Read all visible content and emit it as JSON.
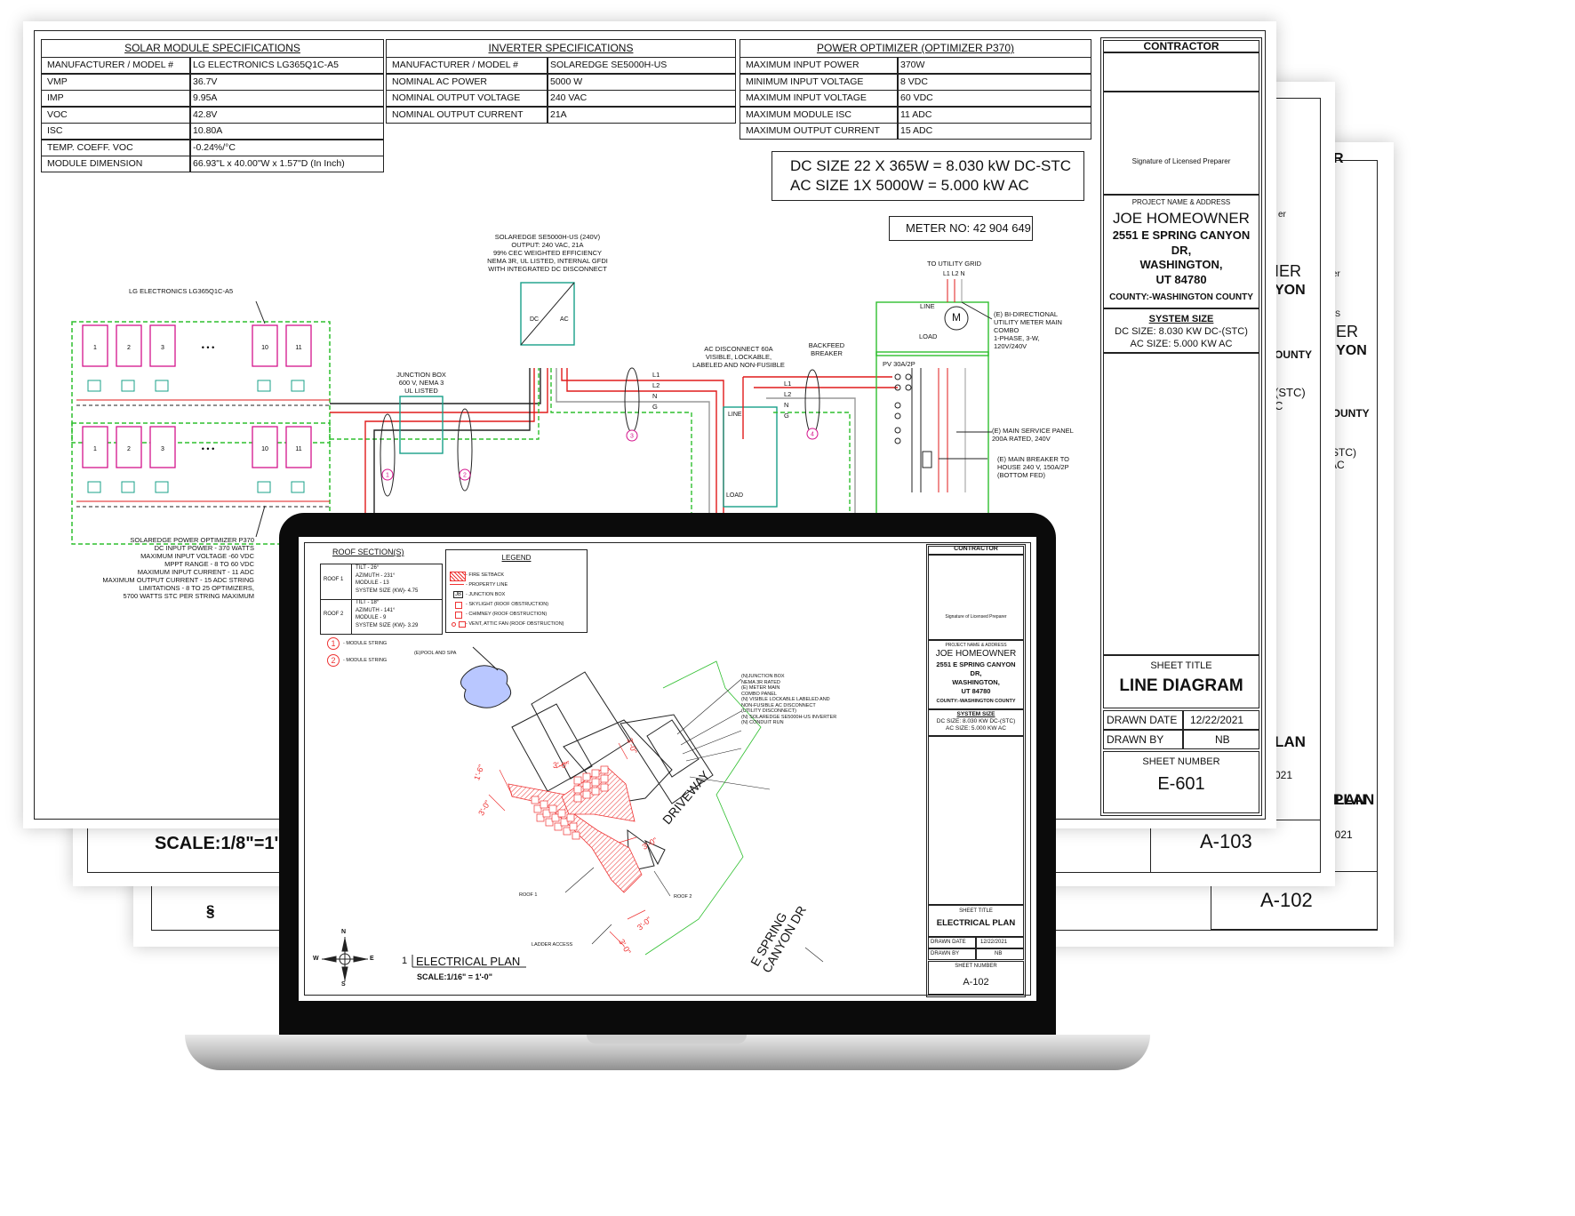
{
  "back_sheet_a102": {
    "fragments": [
      "R",
      "arer",
      "ESS",
      "NER",
      "ANYON",
      "COUNTY",
      "-(STC)",
      "AC",
      "LAN",
      "2021"
    ],
    "scale_label": "SCALE:1/8\"=1'-",
    "north_label": "S",
    "sheet_number": "A-102"
  },
  "back_sheet_a103": {
    "fragments": [
      "er",
      "IER",
      "YON",
      "OUNTY",
      "(STC)",
      "C",
      "LAN",
      "021",
      "PLAN"
    ],
    "sheet_number": "A-103"
  },
  "main_sheet": {
    "solar_module": {
      "title": "SOLAR MODULE SPECIFICATIONS",
      "rows": [
        [
          "MANUFACTURER / MODEL #",
          "LG ELECTRONICS LG365Q1C-A5"
        ],
        [
          "VMP",
          "36.7V"
        ],
        [
          "IMP",
          "9.95A"
        ],
        [
          "VOC",
          "42.8V"
        ],
        [
          "ISC",
          "10.80A"
        ],
        [
          "TEMP. COEFF. VOC",
          "-0.24%/°C"
        ],
        [
          "MODULE DIMENSION",
          "66.93\"L x 40.00\"W x 1.57\"D (In Inch)"
        ]
      ]
    },
    "inverter": {
      "title": "INVERTER  SPECIFICATIONS",
      "rows": [
        [
          "MANUFACTURER / MODEL #",
          "SOLAREDGE SE5000H-US"
        ],
        [
          "NOMINAL AC POWER",
          "5000 W"
        ],
        [
          "NOMINAL OUTPUT VOLTAGE",
          "240 VAC"
        ],
        [
          "NOMINAL OUTPUT CURRENT",
          " 21A"
        ]
      ]
    },
    "optimizer": {
      "title": "POWER OPTIMIZER (OPTIMIZER  P370)",
      "rows": [
        [
          "MAXIMUM INPUT POWER",
          "370W"
        ],
        [
          "MINIMUM INPUT VOLTAGE",
          "8 VDC"
        ],
        [
          "MAXIMUM INPUT VOLTAGE",
          "60 VDC"
        ],
        [
          "MAXIMUM MODULE ISC",
          "11 ADC"
        ],
        [
          "MAXIMUM OUTPUT CURRENT",
          "15 ADC"
        ]
      ]
    },
    "size_box": [
      "DC SIZE 22 X 365W = 8.030 kW DC-STC",
      "AC SIZE 1X 5000W = 5.000 kW AC"
    ],
    "meter_no": "METER NO: 42 904 649",
    "labels": {
      "module_label": "LG ELECTRONICS LG365Q1C-A5",
      "inverter_note": [
        "SOLAREDGE SE5000H-US (240V)",
        "OUTPUT: 240 VAC, 21A",
        "99% CEC WEIGHTED EFFICIENCY",
        "NEMA 3R, UL LISTED, INTERNAL GFDI",
        "WITH INTEGRATED DC DISCONNECT"
      ],
      "to_grid": "TO UTILITY GRID",
      "grid_lines": "L1 L2  N",
      "meter_note": [
        "(E) BI-DIRECTIONAL",
        "UTILITY METER MAIN",
        "COMBO",
        "1-PHASE, 3-W,",
        "120V/240V"
      ],
      "line": "LINE",
      "load": "LOAD",
      "meter_symbol": "M",
      "ac_disconnect": [
        "AC DISCONNECT 60A",
        "VISIBLE, LOCKABLE,",
        "LABELED AND NON-FUSIBLE"
      ],
      "backfeed": [
        "BACKFEED",
        "BREAKER"
      ],
      "pv_breaker": "PV 30A/2P",
      "junction_box": [
        "JUNCTION BOX",
        "600 V, NEMA 3",
        "UL LISTED"
      ],
      "main_panel": [
        "(E) MAIN SERVICE PANEL",
        "200A RATED, 240V"
      ],
      "main_breaker": [
        "(E) MAIN BREAKER TO",
        "HOUSE 240 V, 150A/2P",
        "(BOTTOM FED)"
      ],
      "optimizer_note": [
        "SOLAREDGE POWER OPTIMIZER P370",
        "DC INPUT POWER - 370 WATTS",
        "MAXIMUM INPUT VOLTAGE -60 VDC",
        "MPPT RANGE - 8 TO 60 VDC",
        "MAXIMUM INPUT CURRENT - 11 ADC",
        "MAXIMUM OUTPUT CURRENT - 15 ADC STRING",
        "LIMITATIONS - 8 TO 25 OPTIMIZERS,",
        "5700 WATTS STC PER STRING MAXIMUM"
      ],
      "wire_tags": [
        "L1",
        "L2",
        "N",
        "G"
      ],
      "module_numbers": [
        "1",
        "2",
        "3",
        "10",
        "11"
      ],
      "dots": "•   •   •",
      "circle_tags": [
        "1",
        "2",
        "3",
        "4"
      ],
      "dc": "DC",
      "ac": "AC"
    },
    "title_block": {
      "contractor": "CONTRACTOR",
      "signature": "Signature of Licensed Preparer",
      "project_label": "PROJECT NAME & ADDRESS",
      "name": "JOE HOMEOWNER",
      "address": [
        "2551 E SPRING CANYON",
        "DR,",
        "WASHINGTON,",
        "UT 84780"
      ],
      "county": "COUNTY:-WASHINGTON COUNTY",
      "system_size_label": "SYSTEM SIZE",
      "dc_size": "DC SIZE: 8.030 KW DC-(STC)",
      "ac_size": "AC SIZE: 5.000 KW AC",
      "sheet_title_label": "SHEET TITLE",
      "sheet_title": "LINE DIAGRAM",
      "drawn_date_label": "DRAWN DATE",
      "drawn_date": "12/22/2021",
      "drawn_by_label": "DRAWN BY",
      "drawn_by": "NB",
      "sheet_number_label": "SHEET NUMBER",
      "sheet_number": "E-601"
    }
  },
  "laptop_sheet": {
    "roof_sections_title": "ROOF SECTION(S)",
    "roofs": [
      {
        "name": "ROOF 1",
        "lines": [
          "TILT - 26°",
          "AZIMUTH - 231°",
          "MODULE - 13",
          "SYSTEM SIZE (KW)- 4.75"
        ]
      },
      {
        "name": "ROOF 2",
        "lines": [
          "TILT - 18°",
          "AZIMUTH - 141°",
          "MODULE - 9",
          "SYSTEM SIZE (KW)- 3.29"
        ]
      }
    ],
    "legend_title": "LEGEND",
    "legend_items": [
      "- FIRE SETBACK",
      "- PROPERTY LINE",
      "- JUNCTION BOX",
      "- SKYLIGHT (ROOF OBSTRUCTION)",
      "- CHIMNEY (ROOF OBSTRUCTION)",
      "- VENT, ATTIC FAN (ROOF OBSTRUCTION)"
    ],
    "jb_symbol": "JB",
    "string_1": "- MODULE STRING",
    "string_2": "- MODULE STRING",
    "string_numbers": [
      "1",
      "2"
    ],
    "pool": "(E)POOL AND SPA",
    "callouts": [
      "(N)JUNCTION BOX",
      "NEMA 3R RATED",
      "(E) METER MAIN",
      "COMBO PANEL",
      "(N) VISIBLE LOCKABLE LABELED AND",
      "NON-FUSIBLE AC DISCONNECT",
      "(UTILITY DISCONNECT)",
      "(N) SOLAREDGE SE5000H-US INVERTER",
      "(N) CONDUIT RUN"
    ],
    "roof1": "ROOF 1",
    "roof2": "ROOF 2",
    "ladder": "LADDER ACCESS",
    "driveway": "DRIVEWAY",
    "street": [
      "E SPRING",
      "CANYON DR"
    ],
    "dims": [
      "1'-6\"",
      "3'-0\"",
      "3'-0\"",
      "3'-0\"",
      "3'-0\"",
      "3'-0\"",
      "3'-0\""
    ],
    "compass": [
      "N",
      "S",
      "E",
      "W"
    ],
    "plan_number": "1",
    "plan_title": "ELECTRICAL PLAN",
    "plan_scale": "SCALE:1/16\" = 1'-0\"",
    "title_block": {
      "contractor": "CONTRACTOR",
      "signature": "Signature of Licensed Preparer",
      "project_label": "PROJECT NAME & ADDRESS",
      "name": "JOE HOMEOWNER",
      "address": [
        "2551 E SPRING CANYON",
        "DR,",
        "WASHINGTON,",
        "UT 84780"
      ],
      "county": "COUNTY:-WASHINGTON COUNTY",
      "system_size_label": "SYSTEM SIZE",
      "dc_size": "DC SIZE: 8.030 KW DC-(STC)",
      "ac_size": "AC SIZE: 5.000 KW AC",
      "sheet_title_label": "SHEET TITLE",
      "sheet_title": "ELECTRICAL PLAN",
      "drawn_date_label": "DRAWN DATE",
      "drawn_date": "12/22/2021",
      "drawn_by_label": "DRAWN BY",
      "drawn_by": "NB",
      "sheet_number_label": "SHEET NUMBER",
      "sheet_number": "A-102"
    }
  },
  "colors": {
    "pv_magenta": "#d4148c",
    "wire_red": "#e01b1b",
    "ground_green": "#2fbf2f",
    "teal": "#18a089",
    "setback_red": "#e33"
  }
}
